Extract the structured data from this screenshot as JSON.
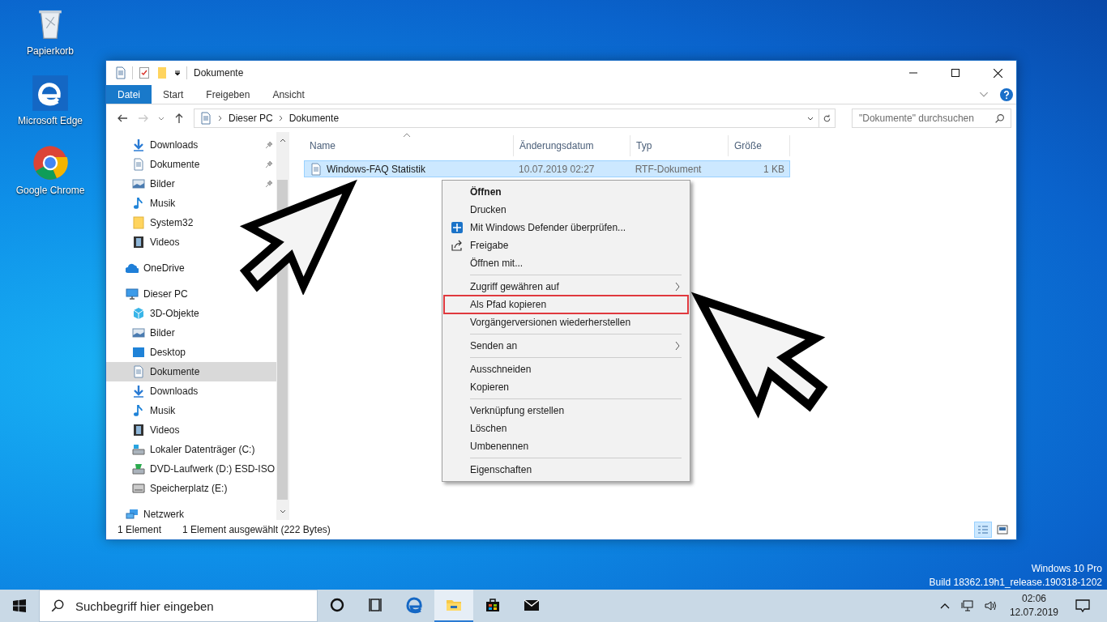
{
  "desktop_icons": [
    {
      "label": "Papierkorb",
      "kind": "recycle"
    },
    {
      "label": "Microsoft Edge",
      "kind": "edge"
    },
    {
      "label": "Google Chrome",
      "kind": "chrome"
    }
  ],
  "window": {
    "title": "Dokumente"
  },
  "ribbon_tabs": [
    {
      "label": "Datei",
      "kind": "file",
      "selected": false
    },
    {
      "label": "Start",
      "kind": "tab",
      "selected": false
    },
    {
      "label": "Freigeben",
      "kind": "tab",
      "selected": false
    },
    {
      "label": "Ansicht",
      "kind": "tab",
      "selected": false
    }
  ],
  "address": {
    "breadcrumbs": [
      "Dieser PC",
      "Dokumente"
    ]
  },
  "search": {
    "placeholder": "\"Dokumente\" durchsuchen"
  },
  "quick_access": [
    {
      "label": "Downloads",
      "kind": "download",
      "pinned": true,
      "selected": false
    },
    {
      "label": "Dokumente",
      "kind": "doc",
      "pinned": true,
      "selected": false
    },
    {
      "label": "Bilder",
      "kind": "pictures",
      "pinned": true,
      "selected": false
    },
    {
      "label": "Musik",
      "kind": "music",
      "pinned": false,
      "selected": false
    },
    {
      "label": "System32",
      "kind": "folder",
      "pinned": false,
      "selected": false
    },
    {
      "label": "Videos",
      "kind": "video",
      "pinned": false,
      "selected": false
    }
  ],
  "tree": [
    {
      "label": "OneDrive",
      "kind": "cloud",
      "selected": false
    },
    {
      "label": "Dieser PC",
      "kind": "pc",
      "selected": false,
      "children": [
        {
          "label": "3D-Objekte",
          "kind": "cube",
          "selected": false
        },
        {
          "label": "Bilder",
          "kind": "pictures",
          "selected": false
        },
        {
          "label": "Desktop",
          "kind": "desktop",
          "selected": false
        },
        {
          "label": "Dokumente",
          "kind": "doc",
          "selected": true
        },
        {
          "label": "Downloads",
          "kind": "download",
          "selected": false
        },
        {
          "label": "Musik",
          "kind": "music",
          "selected": false
        },
        {
          "label": "Videos",
          "kind": "video",
          "selected": false
        },
        {
          "label": "Lokaler Datenträger (C:)",
          "kind": "drive",
          "selected": false
        },
        {
          "label": "DVD-Laufwerk (D:) ESD-ISO",
          "kind": "dvd",
          "selected": false
        },
        {
          "label": "Speicherplatz (E:)",
          "kind": "storage",
          "selected": false
        }
      ]
    },
    {
      "label": "Netzwerk",
      "kind": "network",
      "selected": false
    }
  ],
  "columns": [
    {
      "label": "Name",
      "sorted": true
    },
    {
      "label": "Änderungsdatum",
      "sorted": false
    },
    {
      "label": "Typ",
      "sorted": false
    },
    {
      "label": "Größe",
      "sorted": false
    }
  ],
  "rows": [
    {
      "name": "Windows-FAQ Statistik",
      "date": "10.07.2019 02:27",
      "type": "RTF-Dokument",
      "size": "1 KB",
      "selected": true
    }
  ],
  "context_menu": [
    {
      "kind": "plain",
      "label": "Öffnen",
      "default": true
    },
    {
      "kind": "plain",
      "label": "Drucken"
    },
    {
      "kind": "shield",
      "label": "Mit Windows Defender überprüfen..."
    },
    {
      "kind": "share",
      "label": "Freigabe"
    },
    {
      "kind": "plain",
      "label": "Öffnen mit..."
    },
    {
      "kind": "separator"
    },
    {
      "kind": "plain",
      "label": "Zugriff gewähren auf",
      "submenu": true
    },
    {
      "kind": "plain",
      "label": "Als Pfad kopieren",
      "annotated": true
    },
    {
      "kind": "plain",
      "label": "Vorgängerversionen wiederherstellen"
    },
    {
      "kind": "separator"
    },
    {
      "kind": "plain",
      "label": "Senden an",
      "submenu": true
    },
    {
      "kind": "separator"
    },
    {
      "kind": "plain",
      "label": "Ausschneiden"
    },
    {
      "kind": "plain",
      "label": "Kopieren"
    },
    {
      "kind": "separator"
    },
    {
      "kind": "plain",
      "label": "Verknüpfung erstellen"
    },
    {
      "kind": "plain",
      "label": "Löschen"
    },
    {
      "kind": "plain",
      "label": "Umbenennen"
    },
    {
      "kind": "separator"
    },
    {
      "kind": "plain",
      "label": "Eigenschaften"
    }
  ],
  "status_bar": {
    "count": "1 Element",
    "selection": "1 Element ausgewählt (222 Bytes)",
    "views": [
      {
        "kind": "details",
        "selected": true
      },
      {
        "kind": "tiles",
        "selected": false
      }
    ]
  },
  "os_info": [
    "Windows 10 Pro",
    "Build 18362.19h1_release.190318-1202"
  ],
  "taskbar": {
    "search_placeholder": "Suchbegriff hier eingeben",
    "apps": [
      {
        "kind": "cortana",
        "selected": false
      },
      {
        "kind": "taskview",
        "selected": false
      },
      {
        "kind": "edge",
        "selected": false
      },
      {
        "kind": "explorer",
        "selected": true
      },
      {
        "kind": "store",
        "selected": false
      },
      {
        "kind": "mail",
        "selected": false
      }
    ],
    "time": "02:06",
    "date": "12.07.2019"
  }
}
